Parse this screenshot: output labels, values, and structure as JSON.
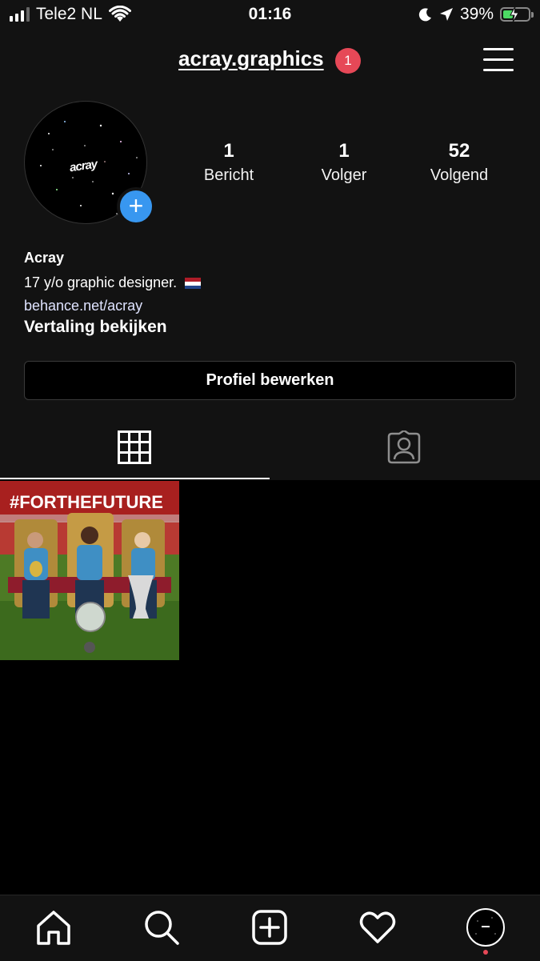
{
  "status_bar": {
    "carrier": "Tele2 NL",
    "time": "01:16",
    "battery_percent": "39%",
    "battery_level": 0.39,
    "icons": [
      "signal-icon",
      "wifi-icon",
      "moon-icon",
      "location-arrow-icon",
      "battery-icon"
    ]
  },
  "header": {
    "username": "acray.graphics",
    "notification_count": "1"
  },
  "profile": {
    "avatar_text": "acray",
    "stats": [
      {
        "value": "1",
        "label": "Bericht"
      },
      {
        "value": "1",
        "label": "Volger"
      },
      {
        "value": "52",
        "label": "Volgend"
      }
    ],
    "name": "Acray",
    "bio": "17 y/o graphic designer.",
    "link": "behance.net/acray",
    "translate_label": "Vertaling bekijken",
    "edit_button": "Profiel bewerken"
  },
  "tabs": [
    {
      "icon": "grid-icon",
      "active": true
    },
    {
      "icon": "tagged-person-icon",
      "active": false
    }
  ],
  "posts": [
    {
      "caption_text": "#FORTHEFUTURE"
    }
  ],
  "bottom_nav": [
    {
      "icon": "home-icon"
    },
    {
      "icon": "search-icon"
    },
    {
      "icon": "add-post-icon"
    },
    {
      "icon": "heart-icon"
    },
    {
      "icon": "profile-avatar-icon"
    }
  ],
  "colors": {
    "background": "#121212",
    "badge": "#e64857",
    "add_button": "#3897f0",
    "battery": "#4cd964"
  }
}
